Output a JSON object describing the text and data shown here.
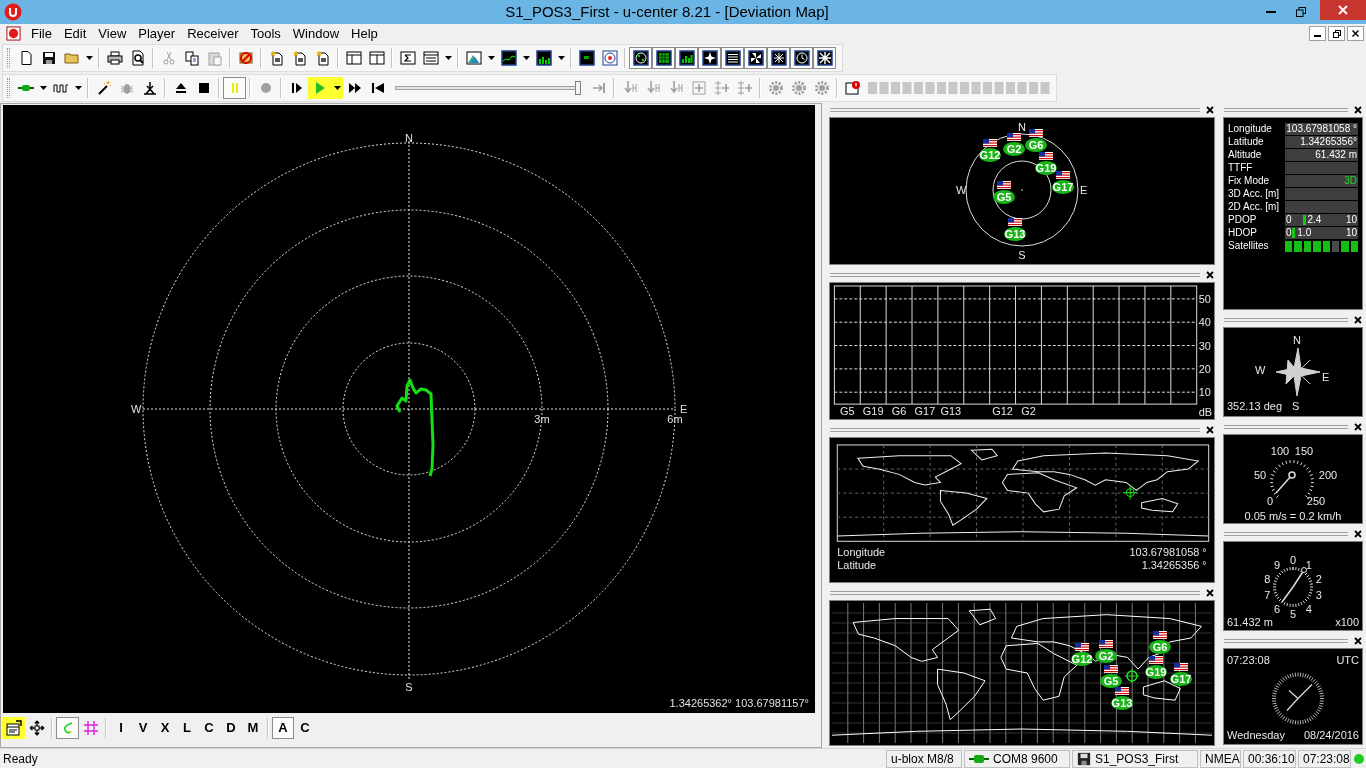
{
  "window": {
    "title": "S1_POS3_First - u-center 8.21 - [Deviation Map]"
  },
  "menu": [
    "File",
    "Edit",
    "View",
    "Player",
    "Receiver",
    "Tools",
    "Window",
    "Help"
  ],
  "toolbar_main": [
    [
      {
        "kind": "new",
        "disabled": false,
        "pressed": false,
        "highlighted": false
      },
      {
        "kind": "save",
        "disabled": false,
        "pressed": false,
        "highlighted": false
      },
      {
        "kind": "open",
        "disabled": false,
        "pressed": false,
        "highlighted": false
      },
      {
        "kind": "caret",
        "disabled": false,
        "pressed": false,
        "highlighted": false
      }
    ],
    [
      {
        "kind": "print",
        "disabled": false,
        "pressed": false,
        "highlighted": false
      },
      {
        "kind": "preview",
        "disabled": false,
        "pressed": false,
        "highlighted": false
      }
    ],
    [
      {
        "kind": "cut",
        "disabled": true,
        "pressed": false,
        "highlighted": false
      },
      {
        "kind": "copy",
        "disabled": false,
        "pressed": false,
        "highlighted": false
      },
      {
        "kind": "paste",
        "disabled": true,
        "pressed": false,
        "highlighted": false
      }
    ],
    [
      {
        "kind": "cancel",
        "disabled": false,
        "pressed": false,
        "highlighted": false
      }
    ],
    [
      {
        "kind": "doc_star",
        "disabled": false,
        "pressed": false,
        "highlighted": false
      },
      {
        "kind": "doc_star",
        "disabled": false,
        "pressed": false,
        "highlighted": false
      },
      {
        "kind": "doc_star",
        "disabled": false,
        "pressed": false,
        "highlighted": false
      }
    ],
    [
      {
        "kind": "layout",
        "disabled": false,
        "pressed": false,
        "highlighted": false
      },
      {
        "kind": "layout2",
        "disabled": false,
        "pressed": false,
        "highlighted": false
      }
    ],
    [
      {
        "kind": "sigma",
        "disabled": false,
        "pressed": false,
        "highlighted": false
      },
      {
        "kind": "list",
        "disabled": false,
        "pressed": false,
        "highlighted": false
      },
      {
        "kind": "caret",
        "disabled": false,
        "pressed": false,
        "highlighted": false
      }
    ],
    [
      {
        "kind": "chart_map",
        "disabled": false,
        "pressed": false,
        "highlighted": false
      },
      {
        "kind": "caret",
        "disabled": false,
        "pressed": false,
        "highlighted": false
      },
      {
        "kind": "line_chart",
        "disabled": false,
        "pressed": false,
        "highlighted": false
      },
      {
        "kind": "caret",
        "disabled": false,
        "pressed": false,
        "highlighted": false
      },
      {
        "kind": "bar_chart",
        "disabled": false,
        "pressed": false,
        "highlighted": false
      },
      {
        "kind": "caret",
        "disabled": false,
        "pressed": false,
        "highlighted": false
      }
    ],
    [
      {
        "kind": "black_window",
        "disabled": false,
        "pressed": false,
        "highlighted": false
      },
      {
        "kind": "radar_window",
        "disabled": false,
        "pressed": false,
        "highlighted": false
      }
    ],
    [
      {
        "kind": "view_sky",
        "disabled": false,
        "pressed": true,
        "highlighted": false
      },
      {
        "kind": "view_map",
        "disabled": false,
        "pressed": true,
        "highlighted": false
      },
      {
        "kind": "view_signal",
        "disabled": false,
        "pressed": true,
        "highlighted": false
      },
      {
        "kind": "view_compass",
        "disabled": false,
        "pressed": true,
        "highlighted": false
      },
      {
        "kind": "view_table",
        "disabled": false,
        "pressed": true,
        "highlighted": false
      },
      {
        "kind": "view_fan",
        "disabled": false,
        "pressed": true,
        "highlighted": false
      },
      {
        "kind": "view_grid",
        "disabled": false,
        "pressed": true,
        "highlighted": false
      },
      {
        "kind": "view_clock",
        "disabled": false,
        "pressed": true,
        "highlighted": false
      },
      {
        "kind": "view_star",
        "disabled": false,
        "pressed": true,
        "highlighted": false
      }
    ]
  ],
  "toolbar_player": [
    [
      {
        "kind": "connector",
        "disabled": false,
        "pressed": false,
        "highlighted": false
      },
      {
        "kind": "caret",
        "disabled": false,
        "pressed": false,
        "highlighted": false
      },
      {
        "kind": "wave",
        "disabled": false,
        "pressed": false,
        "highlighted": false
      },
      {
        "kind": "caret",
        "disabled": false,
        "pressed": false,
        "highlighted": false
      }
    ],
    [
      {
        "kind": "wand",
        "disabled": false,
        "pressed": false,
        "highlighted": false
      },
      {
        "kind": "bug",
        "disabled": true,
        "pressed": false,
        "highlighted": false
      },
      {
        "kind": "antenna",
        "disabled": false,
        "pressed": false,
        "highlighted": false
      }
    ],
    [
      {
        "kind": "eject",
        "disabled": false,
        "pressed": false,
        "highlighted": false
      },
      {
        "kind": "stop",
        "disabled": false,
        "pressed": false,
        "highlighted": false
      }
    ],
    [
      {
        "kind": "pause",
        "disabled": false,
        "pressed": true,
        "highlighted": false
      }
    ],
    [
      {
        "kind": "record",
        "disabled": true,
        "pressed": false,
        "highlighted": false
      }
    ],
    [
      {
        "kind": "step",
        "disabled": false,
        "pressed": false,
        "highlighted": false
      },
      {
        "kind": "play",
        "disabled": false,
        "pressed": false,
        "highlighted": true
      },
      {
        "kind": "caret",
        "disabled": false,
        "pressed": false,
        "highlighted": true
      },
      {
        "kind": "ff",
        "disabled": false,
        "pressed": false,
        "highlighted": false
      },
      {
        "kind": "rewind_start",
        "disabled": false,
        "pressed": false,
        "highlighted": false
      },
      {
        "kind": "slider",
        "level": 1
      },
      {
        "kind": "skip_end",
        "disabled": true,
        "pressed": false,
        "highlighted": false
      }
    ],
    [
      {
        "kind": "probe",
        "disabled": true,
        "pressed": false,
        "highlighted": false
      },
      {
        "kind": "probe",
        "disabled": true,
        "pressed": false,
        "highlighted": false
      },
      {
        "kind": "probe",
        "disabled": true,
        "pressed": false,
        "highlighted": false
      },
      {
        "kind": "plus_box",
        "disabled": true,
        "pressed": false,
        "highlighted": false
      },
      {
        "kind": "mux",
        "disabled": true,
        "pressed": false,
        "highlighted": false
      },
      {
        "kind": "mux",
        "disabled": true,
        "pressed": false,
        "highlighted": false
      }
    ],
    [
      {
        "kind": "gear",
        "disabled": true,
        "pressed": false,
        "highlighted": false
      },
      {
        "kind": "gear",
        "disabled": true,
        "pressed": false,
        "highlighted": false
      },
      {
        "kind": "gear",
        "disabled": true,
        "pressed": false,
        "highlighted": false
      }
    ],
    [
      {
        "kind": "alert_window",
        "disabled": false,
        "pressed": false,
        "highlighted": false
      },
      {
        "kind": "blockbar"
      }
    ]
  ],
  "deviation_map": {
    "directions": {
      "north": "N",
      "south": "S",
      "west": "W",
      "east": "E"
    },
    "ring_labels": [
      "3m",
      "6m"
    ],
    "coordinates": "1.34265362° 103.67981157°"
  },
  "map_toolbar": [
    [
      {
        "kind": "properties",
        "pressed": false,
        "highlighted": true
      },
      {
        "kind": "move",
        "pressed": false,
        "highlighted": false
      }
    ],
    [
      {
        "kind": "track",
        "pressed": true,
        "highlighted": false
      },
      {
        "kind": "grid",
        "pressed": false,
        "highlighted": false
      }
    ],
    [
      {
        "kind": "letter",
        "label": "I",
        "pressed": false,
        "highlighted": false
      },
      {
        "kind": "letter",
        "label": "V",
        "pressed": false,
        "highlighted": false
      },
      {
        "kind": "letter",
        "label": "X",
        "pressed": false,
        "highlighted": false
      },
      {
        "kind": "letter",
        "label": "L",
        "pressed": false,
        "highlighted": false
      },
      {
        "kind": "letter",
        "label": "C",
        "pressed": false,
        "highlighted": false
      },
      {
        "kind": "letter",
        "label": "D",
        "pressed": false,
        "highlighted": false
      },
      {
        "kind": "letter",
        "label": "M",
        "pressed": false,
        "highlighted": false
      }
    ],
    [
      {
        "kind": "letter",
        "label": "A",
        "pressed": true,
        "highlighted": false
      },
      {
        "kind": "letter",
        "label": "C",
        "pressed": false,
        "highlighted": false
      }
    ]
  ],
  "sky_view": {
    "directions": {
      "north": "N",
      "east": "E",
      "south": "S",
      "west": "W"
    },
    "satellites": [
      {
        "label": "G12"
      },
      {
        "label": "G2"
      },
      {
        "label": "G6"
      },
      {
        "label": "G19"
      },
      {
        "label": "G17"
      },
      {
        "label": "G5"
      },
      {
        "label": "G13"
      }
    ]
  },
  "signal_view": {
    "yticks": [
      "50",
      "40",
      "30",
      "20",
      "10"
    ],
    "unit": "dB",
    "satellites": [
      {
        "label": "G5"
      },
      {
        "label": "G19"
      },
      {
        "label": "G6"
      },
      {
        "label": "G17"
      },
      {
        "label": "G13"
      },
      {
        "label": "G12"
      },
      {
        "label": "G2"
      }
    ]
  },
  "world_view": {
    "rows": [
      {
        "label": "Longitude",
        "value": "103.67981058 °"
      },
      {
        "label": "Latitude",
        "value": "1.34265356 °"
      }
    ]
  },
  "satellite_map": {
    "satellites": [
      {
        "label": "G12"
      },
      {
        "label": "G2"
      },
      {
        "label": "G6"
      },
      {
        "label": "G19"
      },
      {
        "label": "G17"
      },
      {
        "label": "G5"
      },
      {
        "label": "G13"
      }
    ]
  },
  "position": {
    "rows": [
      {
        "kind": "value",
        "label": "Longitude",
        "value": "103.67981058 °"
      },
      {
        "kind": "value",
        "label": "Latitude",
        "value": "1.34265356°"
      },
      {
        "kind": "value",
        "label": "Altitude",
        "value": "61.432 m"
      },
      {
        "kind": "value",
        "label": "TTFF"
      },
      {
        "kind": "fix",
        "label": "Fix Mode",
        "value": "3D"
      },
      {
        "kind": "value",
        "label": "3D Acc. [m]"
      },
      {
        "kind": "value",
        "label": "2D Acc. [m]"
      },
      {
        "kind": "dop",
        "label": "PDOP",
        "min": "0",
        "max": "10",
        "reading": "2.4",
        "level": 0.24
      },
      {
        "kind": "dop",
        "label": "HDOP",
        "min": "0",
        "max": "10",
        "reading": "1.0",
        "level": 0.1
      },
      {
        "kind": "satellites",
        "label": "Satellites",
        "blocks": [
          {
            "used": true
          },
          {
            "used": true
          },
          {
            "used": true
          },
          {
            "used": true
          },
          {
            "used": true
          },
          {
            "used": false
          },
          {
            "used": true
          },
          {
            "used": true
          }
        ]
      }
    ]
  },
  "compass": {
    "north": "N",
    "west": "W",
    "east": "E",
    "south": "S",
    "heading": "352.13 deg"
  },
  "speed": {
    "scale": [
      "0",
      "50",
      "100",
      "150",
      "200",
      "250"
    ],
    "reading": "0.05 m/s = 0.2 km/h"
  },
  "altitude": {
    "scale": [
      "0",
      "1",
      "2",
      "3",
      "4",
      "5",
      "6",
      "7",
      "8",
      "9"
    ],
    "reading": "61.432 m",
    "multiplier": "x100"
  },
  "clock": {
    "time": "07:23:08",
    "zone": "UTC",
    "weekday": "Wednesday",
    "date": "08/24/2016"
  },
  "status_bar": {
    "message": "Ready",
    "receiver": "u-blox M8/8",
    "port": "COM8 9600",
    "file": "S1_POS3_First",
    "protocol": "NMEA",
    "elapsed": "00:36:10",
    "time": "07:23:08",
    "connected": true
  }
}
